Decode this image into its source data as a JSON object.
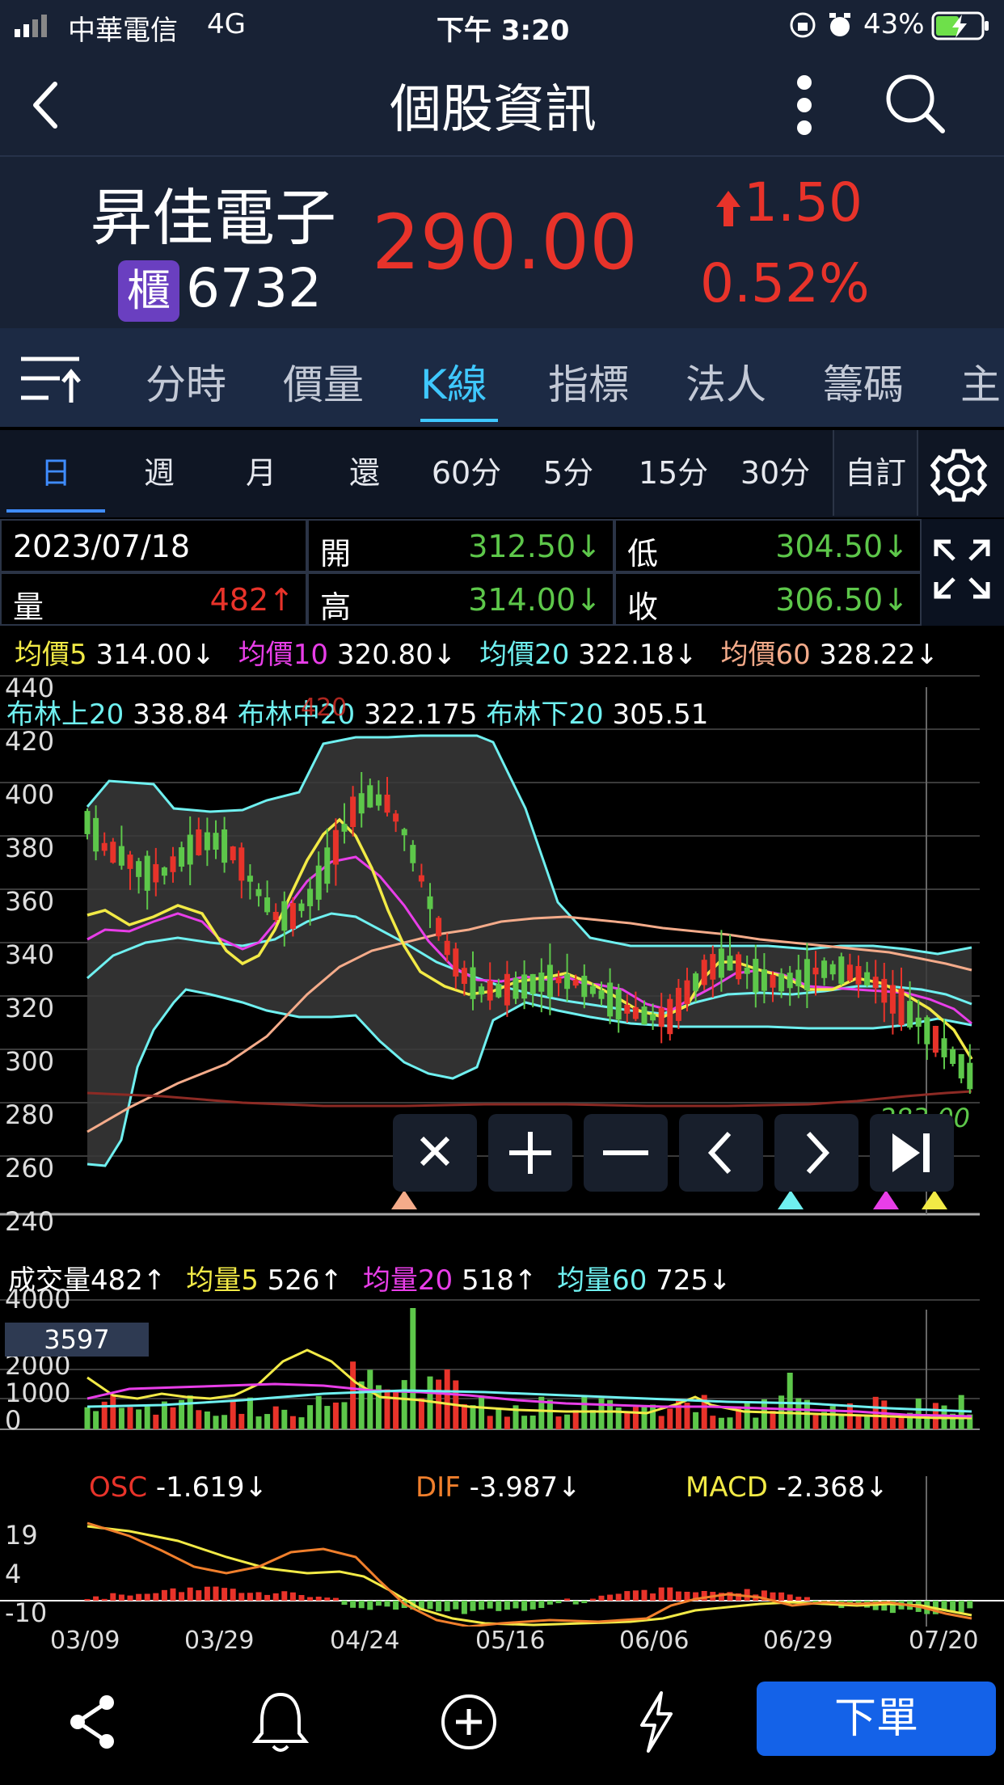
{
  "status_bar": {
    "carrier": "中華電信",
    "network": "4G",
    "time": "下午 3:20",
    "battery": "43%"
  },
  "nav": {
    "title": "個股資訊",
    "back_icon": "back-chevron-icon",
    "more_icon": "more-vertical-icon",
    "search_icon": "search-icon"
  },
  "quote": {
    "name": "昇佳電子",
    "market_badge": "櫃",
    "code": "6732",
    "price": "290.00",
    "change": "1.50",
    "change_pct": "0.52%",
    "up_color": "#e8332a"
  },
  "tabs": {
    "items": [
      "分時",
      "價量",
      "K線",
      "指標",
      "法人",
      "籌碼",
      "主"
    ],
    "active": "K線",
    "active_color": "#3fc8ff"
  },
  "periods": {
    "items": [
      "日",
      "週",
      "月",
      "還",
      "60分",
      "5分",
      "15分",
      "30分"
    ],
    "active": "日",
    "custom": "自訂"
  },
  "info": {
    "date": "2023/07/18",
    "open_label": "開",
    "open": "312.50↓",
    "low_label": "低",
    "low": "304.50↓",
    "volume_label": "量",
    "volume": "482↑",
    "high_label": "高",
    "high": "314.00↓",
    "close_label": "收",
    "close": "306.50↓"
  },
  "ma_legend": [
    {
      "label": "均價5",
      "value": "314.00↓",
      "color": "#f2ea46"
    },
    {
      "label": "均價10",
      "value": "320.80↓",
      "color": "#e83ee8"
    },
    {
      "label": "均價20",
      "value": "322.18↓",
      "color": "#6ff0f0"
    },
    {
      "label": "均價60",
      "value": "328.22↓",
      "color": "#f4ab8a"
    }
  ],
  "bollinger_legend": {
    "upper_label": "布林上20",
    "upper": "338.84",
    "mid_label": "布林中20",
    "mid": "322.175",
    "lower_label": "布林下20",
    "lower": "305.51"
  },
  "price_axis": [
    "440",
    "420",
    "400",
    "380",
    "360",
    "340",
    "320",
    "300",
    "280",
    "260",
    "240"
  ],
  "high_marker": "420",
  "last_price_label": "283.00",
  "chart_controls": [
    "close-icon",
    "plus-icon",
    "minus-icon",
    "chevron-left-icon",
    "chevron-right-icon",
    "skip-to-end-icon"
  ],
  "volume_legend": {
    "vol_label": "成交量",
    "vol": "482↑",
    "ma5_label": "均量5",
    "ma5": "526↑",
    "ma20_label": "均量20",
    "ma20": "518↑",
    "ma60_label": "均量60",
    "ma60": "725↓"
  },
  "volume_axis": [
    "4000",
    "2000",
    "1000",
    "0"
  ],
  "volume_badge": "3597",
  "macd_legend": {
    "osc_label": "OSC",
    "osc": "-1.619↓",
    "dif_label": "DIF",
    "dif": "-3.987↓",
    "macd_label": "MACD",
    "macd": "-2.368↓"
  },
  "macd_axis": [
    "19",
    "4",
    "-10"
  ],
  "date_axis": [
    "03/09",
    "03/29",
    "04/24",
    "05/16",
    "06/06",
    "06/29",
    "07/20"
  ],
  "bottom": {
    "order_button": "下單",
    "icons": [
      "share-icon",
      "bell-icon",
      "add-circle-icon",
      "lightning-icon"
    ]
  },
  "chart_data": {
    "type": "candlestick",
    "ylim": [
      240,
      440
    ],
    "x_start": "03/09",
    "x_end": "07/20",
    "ma_close_approx": [
      385,
      375,
      372,
      366,
      366,
      372,
      378,
      378,
      372,
      360,
      350,
      350,
      358,
      372,
      388,
      395,
      392,
      380,
      360,
      340,
      328,
      322,
      322,
      323,
      325,
      326,
      325,
      322,
      318,
      314,
      312,
      312,
      322,
      330,
      333,
      330,
      326,
      325,
      327,
      330,
      330,
      328,
      325,
      318,
      312,
      305,
      298,
      290
    ],
    "bollinger_upper_approx": [
      380,
      398,
      400,
      398,
      392,
      388,
      388,
      388,
      390,
      392,
      395,
      408,
      418,
      420,
      418,
      418,
      414,
      408,
      378,
      352,
      342,
      340,
      340,
      340,
      342,
      342,
      343,
      344,
      346,
      345,
      342,
      340,
      340,
      340,
      340,
      338,
      338,
      339,
      340,
      340,
      339,
      338,
      337,
      336,
      336,
      337,
      338,
      341
    ],
    "bollinger_lower_approx": [
      260,
      270,
      290,
      310,
      330,
      340,
      346,
      348,
      348,
      344,
      336,
      326,
      318,
      316,
      312,
      305,
      300,
      295,
      292,
      294,
      300,
      306,
      310,
      312,
      312,
      310,
      308,
      306,
      305,
      304,
      304,
      303,
      303,
      305,
      306,
      307,
      306,
      304,
      304,
      304,
      305,
      306,
      307,
      306,
      305,
      303,
      301,
      298
    ],
    "ma60_approx": [
      272,
      280,
      288,
      296,
      304,
      312,
      320,
      326,
      332,
      338,
      342,
      346,
      348,
      350,
      352,
      354,
      355,
      356,
      357,
      357,
      356,
      355,
      353,
      351,
      350,
      349,
      348,
      347,
      346,
      345,
      344,
      343,
      342,
      340,
      339,
      338,
      337,
      335,
      334,
      333,
      332,
      331,
      330,
      329,
      328,
      327,
      326,
      325
    ]
  }
}
